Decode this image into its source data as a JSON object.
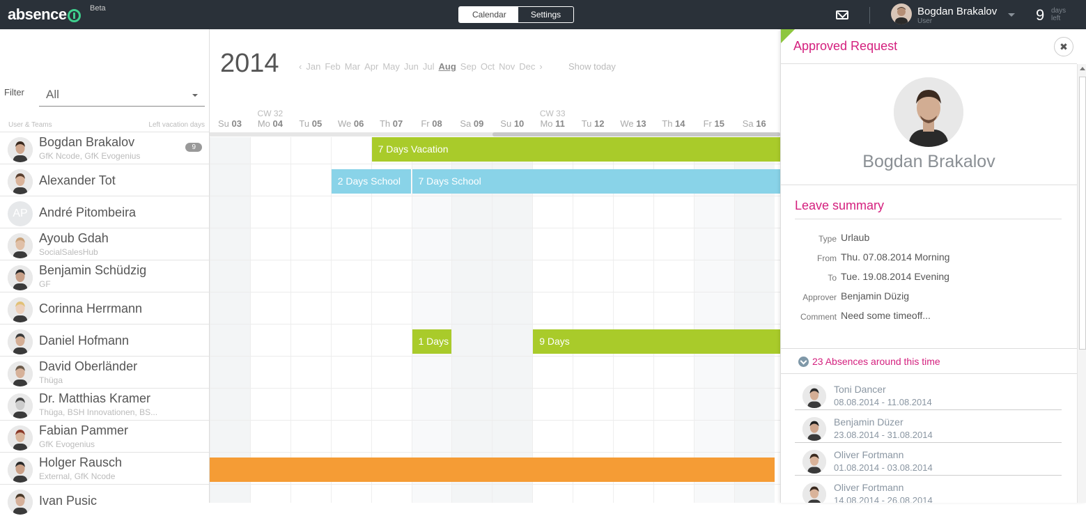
{
  "topbar": {
    "logo": "absence",
    "beta": "Beta",
    "tabs": [
      {
        "label": "Calendar",
        "active": true
      },
      {
        "label": "Settings",
        "active": false
      }
    ],
    "user_name": "Bogdan Brakalov",
    "user_role": "User",
    "days_left": "9",
    "days_left_label1": "days",
    "days_left_label2": "left"
  },
  "sidebar": {
    "filter_label": "Filter",
    "filter_value": "All",
    "col_users": "User & Teams",
    "col_vacation": "Left vacation days",
    "users": [
      {
        "name": "Bogdan Brakalov",
        "sub": "GfK Ncode, GfK Evogenius",
        "badge": "9"
      },
      {
        "name": "Alexander Tot",
        "sub": ""
      },
      {
        "name": "André Pitombeira",
        "sub": "",
        "initials": "AP"
      },
      {
        "name": "Ayoub Gdah",
        "sub": "SocialSalesHub"
      },
      {
        "name": "Benjamin Schüdzig",
        "sub": "GF"
      },
      {
        "name": "Corinna Herrmann",
        "sub": ""
      },
      {
        "name": "Daniel Hofmann",
        "sub": ""
      },
      {
        "name": "David Oberländer",
        "sub": "Thüga"
      },
      {
        "name": "Dr. Matthias Kramer",
        "sub": "Thüga, BSH Innovationen, BS..."
      },
      {
        "name": "Fabian Pammer",
        "sub": "GfK Evogenius"
      },
      {
        "name": "Holger Rausch",
        "sub": "External, GfK Ncode"
      },
      {
        "name": "Ivan Pusic",
        "sub": ""
      }
    ]
  },
  "calendar": {
    "year": "2014",
    "prev": "‹",
    "next": "›",
    "months": [
      "Jan",
      "Feb",
      "Mar",
      "Apr",
      "May",
      "Jun",
      "Jul",
      "Aug",
      "Sep",
      "Oct",
      "Nov",
      "Dec"
    ],
    "current_month": "Aug",
    "show_today": "Show today",
    "days": [
      {
        "wd": "Su",
        "d": "03",
        "cw": ""
      },
      {
        "wd": "Mo",
        "d": "04",
        "cw": "CW 32"
      },
      {
        "wd": "Tu",
        "d": "05",
        "cw": ""
      },
      {
        "wd": "We",
        "d": "06",
        "cw": ""
      },
      {
        "wd": "Th",
        "d": "07",
        "cw": ""
      },
      {
        "wd": "Fr",
        "d": "08",
        "cw": ""
      },
      {
        "wd": "Sa",
        "d": "09",
        "cw": ""
      },
      {
        "wd": "Su",
        "d": "10",
        "cw": ""
      },
      {
        "wd": "Mo",
        "d": "11",
        "cw": "CW 33"
      },
      {
        "wd": "Tu",
        "d": "12",
        "cw": ""
      },
      {
        "wd": "We",
        "d": "13",
        "cw": ""
      },
      {
        "wd": "Th",
        "d": "14",
        "cw": ""
      },
      {
        "wd": "Fr",
        "d": "15",
        "cw": ""
      },
      {
        "wd": "Sa",
        "d": "16",
        "cw": ""
      }
    ],
    "bars": [
      {
        "row": 0,
        "start": 4,
        "end": 14,
        "label": "7 Days Vacation",
        "color": "#a9cb2a"
      },
      {
        "row": 1,
        "start": 3,
        "end": 5,
        "label": "2 Days School",
        "color": "#89d3e8"
      },
      {
        "row": 1,
        "start": 5,
        "end": 14,
        "label": "7 Days School",
        "color": "#89d3e8"
      },
      {
        "row": 6,
        "start": 5,
        "end": 6,
        "label": "1 Days",
        "color": "#a9cb2a"
      },
      {
        "row": 6,
        "start": 8,
        "end": 14,
        "label": "9 Days",
        "color": "#a9cb2a"
      },
      {
        "row": 10,
        "start": 0,
        "end": 14,
        "label": "",
        "color": "#f59c35"
      }
    ]
  },
  "panel": {
    "title": "Approved Request",
    "close": "✖",
    "name": "Bogdan Brakalov",
    "summary_title": "Leave summary",
    "fields": [
      {
        "k": "Type",
        "v": "Urlaub"
      },
      {
        "k": "From",
        "v": "Thu. 07.08.2014 Morning"
      },
      {
        "k": "To",
        "v": "Tue. 19.08.2014 Evening"
      },
      {
        "k": "Approver",
        "v": "Benjamin Düzig"
      },
      {
        "k": "Comment",
        "v": "Need some timeoff..."
      }
    ],
    "absences_title": "23 Absences around this time",
    "absences": [
      {
        "name": "Toni Dancer",
        "dates": "08.08.2014 - 11.08.2014"
      },
      {
        "name": "Benjamin Düzer",
        "dates": "23.08.2014 - 31.08.2014"
      },
      {
        "name": "Oliver Fortmann",
        "dates": "01.08.2014 - 03.08.2014"
      },
      {
        "name": "Oliver Fortmann",
        "dates": "14.08.2014 - 26.08.2014"
      }
    ]
  },
  "colors": {
    "topbar": "#2a3139",
    "accent": "#d4207e",
    "vacation": "#a9cb2a",
    "school": "#89d3e8",
    "orange": "#f59c35"
  }
}
